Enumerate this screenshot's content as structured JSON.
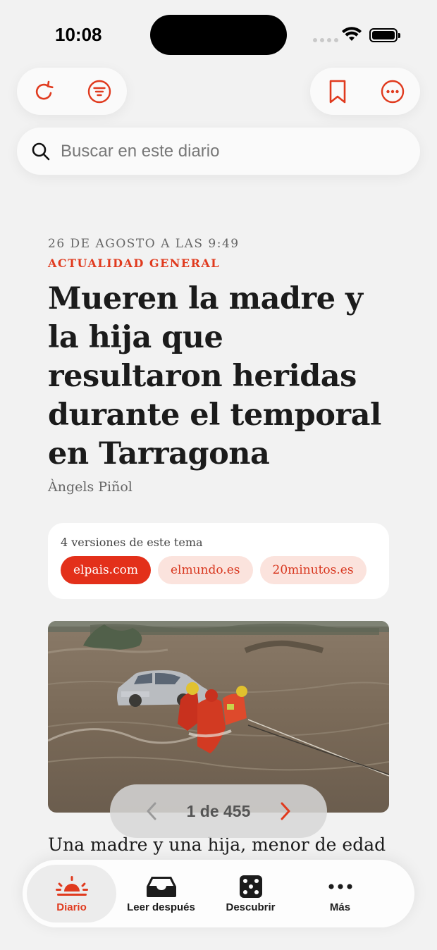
{
  "status_bar": {
    "time": "10:08"
  },
  "toolbar": {
    "left": [
      "refresh-icon",
      "filter-icon"
    ],
    "right": [
      "bookmark-icon",
      "more-icon"
    ],
    "accent": "#e03a1e"
  },
  "search": {
    "placeholder": "Buscar en este diario"
  },
  "article": {
    "date": "26 DE AGOSTO A LAS 9:49",
    "section": "ACTUALIDAD GENERAL",
    "headline": "Mueren la madre y la hija que resultaron heridas durante el temporal en Tarragona",
    "author": "Àngels Piñol",
    "lead": "Una madre y una hija, menor de edad"
  },
  "versions": {
    "title": "4 versiones de este tema",
    "sources": [
      {
        "label": "elpais.com",
        "active": true
      },
      {
        "label": "elmundo.es",
        "active": false
      },
      {
        "label": "20minutos.es",
        "active": false
      }
    ]
  },
  "pager": {
    "text": "1 de 455"
  },
  "tabbar": {
    "tabs": [
      {
        "label": "Diario",
        "icon": "sunrise-icon",
        "active": true
      },
      {
        "label": "Leer después",
        "icon": "inbox-icon",
        "active": false
      },
      {
        "label": "Descubrir",
        "icon": "dice-icon",
        "active": false
      },
      {
        "label": "Más",
        "icon": "ellipsis-icon",
        "active": false
      }
    ]
  }
}
